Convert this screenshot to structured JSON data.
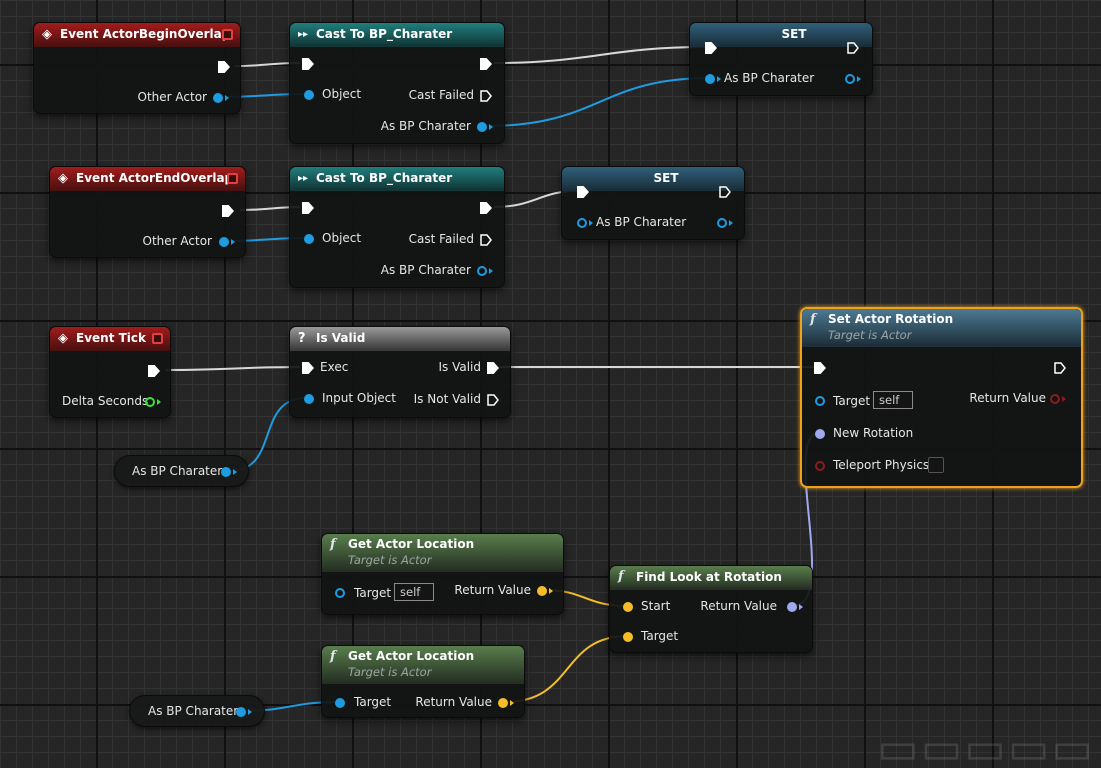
{
  "colors": {
    "object_pin": "#1f9be0",
    "vector_pin": "#f5bd28",
    "rotator_pin": "#a0a8f0",
    "bool_pin": "#8c1c1c",
    "float_pin": "#3ce03c",
    "exec": "#ffffff",
    "selection": "#f0a21a"
  },
  "nodes": {
    "begin_overlap": {
      "title": "Event ActorBeginOverlap",
      "other_actor": "Other Actor"
    },
    "cast1": {
      "title": "Cast To BP_Charater",
      "object": "Object",
      "cast_failed": "Cast Failed",
      "as_bp": "As BP Charater"
    },
    "set1": {
      "title": "SET",
      "as_bp": "As BP Charater"
    },
    "end_overlap": {
      "title": "Event ActorEndOverlap",
      "other_actor": "Other Actor"
    },
    "cast2": {
      "title": "Cast To BP_Charater",
      "object": "Object",
      "cast_failed": "Cast Failed",
      "as_bp": "As BP Charater"
    },
    "set2": {
      "title": "SET",
      "as_bp": "As BP Charater"
    },
    "tick": {
      "title": "Event Tick",
      "delta": "Delta Seconds"
    },
    "is_valid": {
      "title": "Is Valid",
      "exec": "Exec",
      "is_valid": "Is Valid",
      "input_object": "Input Object",
      "is_not_valid": "Is Not Valid"
    },
    "var1": {
      "label": "As BP Charater"
    },
    "set_rot": {
      "title": "Set Actor Rotation",
      "subtitle": "Target is Actor",
      "target": "Target",
      "target_value": "self",
      "return_value": "Return Value",
      "new_rotation": "New Rotation",
      "teleport": "Teleport Physics"
    },
    "get_loc1": {
      "title": "Get Actor Location",
      "subtitle": "Target is Actor",
      "target": "Target",
      "target_value": "self",
      "return_value": "Return Value"
    },
    "find_look": {
      "title": "Find Look at Rotation",
      "start": "Start",
      "target": "Target",
      "return_value": "Return Value"
    },
    "get_loc2": {
      "title": "Get Actor Location",
      "subtitle": "Target is Actor",
      "target": "Target",
      "return_value": "Return Value"
    },
    "var2": {
      "label": "As BP Charater"
    }
  }
}
